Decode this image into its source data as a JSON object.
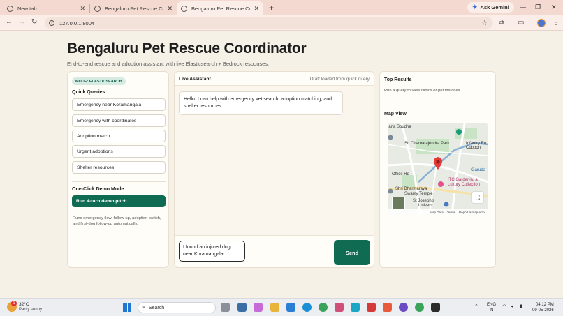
{
  "browser": {
    "tabs": [
      {
        "title": "New tab",
        "active": false
      },
      {
        "title": "Bengaluru Pet Rescue Coordin",
        "active": false
      },
      {
        "title": "Bengaluru Pet Rescue Coordin",
        "active": true
      }
    ],
    "new_tab_glyph": "+",
    "ask_gemini": "Ask Gemini",
    "url": "127.0.0.1:8004"
  },
  "header": {
    "title": "Bengaluru Pet Rescue Coordinator",
    "subtitle": "End-to-end rescue and adoption assistant with live Elasticsearch + Bedrock responses."
  },
  "left_panel": {
    "mode_badge": "MODE: ELASTICSEARCH",
    "quick_queries_heading": "Quick Queries",
    "quick_queries": [
      "Emergency near Koramangala",
      "Emergency with coordinates",
      "Adoption match",
      "Urgent adoptions",
      "Shelter resources"
    ],
    "demo_heading": "One-Click Demo Mode",
    "demo_button": "Run 4-turn demo pitch",
    "demo_note": "Runs emergency flow, follow-up, adoption switch, and first-dog follow-up automatically."
  },
  "assistant": {
    "heading": "Live Assistant",
    "status": "Draft loaded from quick query",
    "messages": [
      "Hello. I can help with emergency vet search, adoption matching, and shelter resources."
    ],
    "input_value": "I found an injured dog near Koramangala",
    "send_label": "Send"
  },
  "right_panel": {
    "results_heading": "Top Results",
    "results_note": "Run a query to view clinics or pet matches.",
    "map_heading": "Map View",
    "map_labels": {
      "l1": "lana Soudha",
      "l2": "Sri Chamarajendra Park",
      "l3": "Cubbon",
      "l4": "Infantry Ro",
      "l5": "Garuda",
      "l6": "ITC Gardenia, a",
      "l7": "Luxury Collection",
      "l8": "Shri Dharmaraya",
      "l9": "Swamy Temple",
      "l10": "St Joseph's",
      "l11": "Univers",
      "l12": "Office Rd"
    },
    "map_footer": [
      "Map Data",
      "Terms",
      "Report a map error"
    ]
  },
  "taskbar": {
    "weather_temp": "32°C",
    "weather_desc": "Partly sunny",
    "weather_badge": "1",
    "search_label": "Search",
    "lang_top": "ENG",
    "lang_bottom": "IN",
    "time": "04:12 PM",
    "date": "09-05-2026"
  },
  "colors": {
    "accent": "#0f6b52",
    "badge_bg": "#d6ece3",
    "page_bg": "#f6f1e7",
    "tabbar_bg": "#f3d9cf"
  }
}
